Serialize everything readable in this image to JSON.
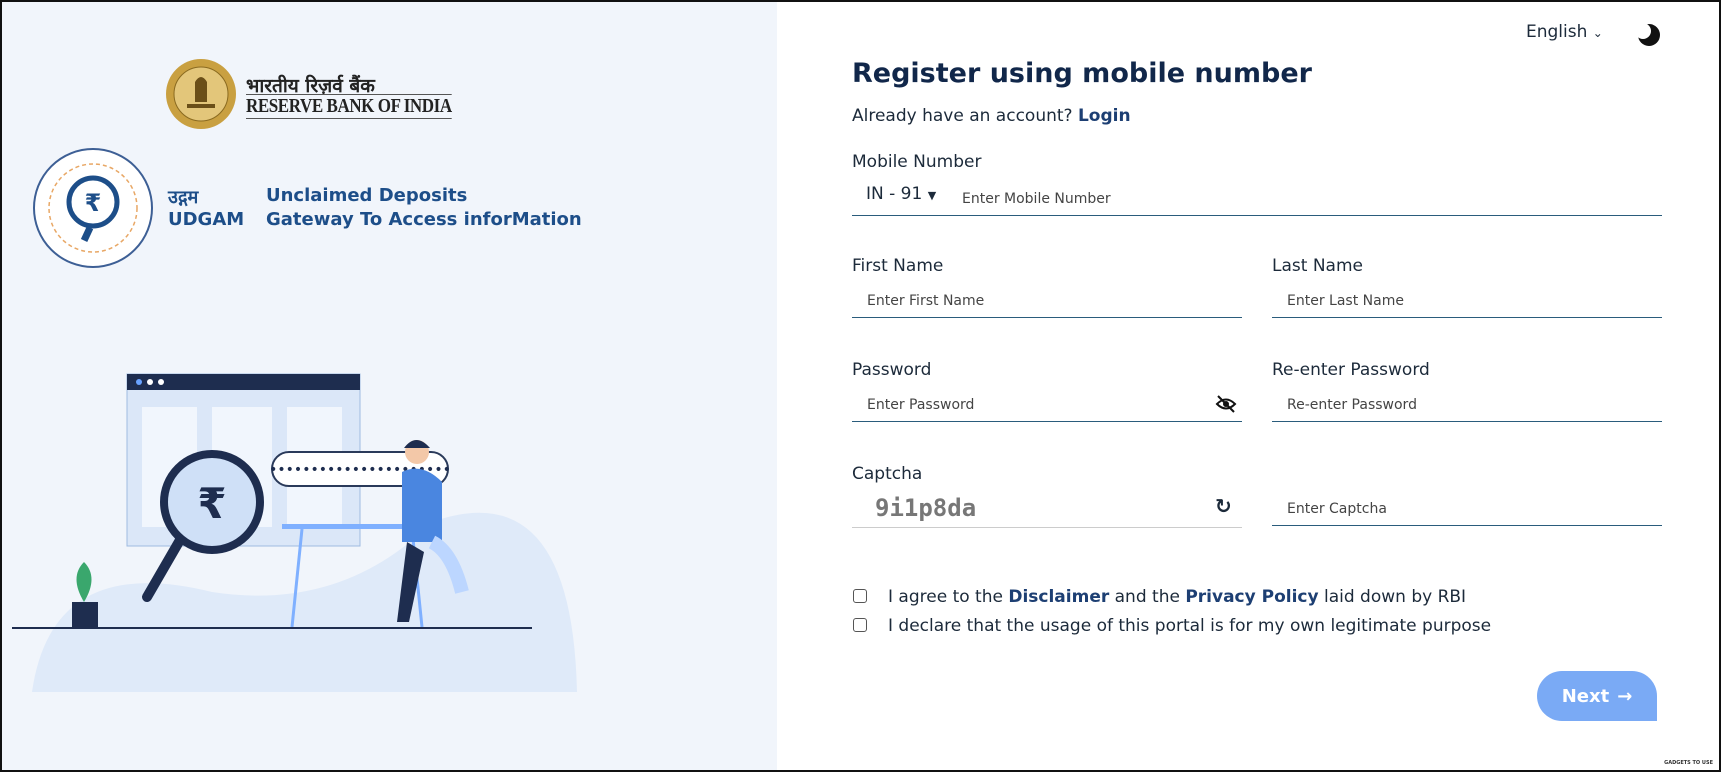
{
  "brand": {
    "rbi_hindi": "भारतीय रिज़र्व बैंक",
    "rbi_english": "RESERVE BANK OF INDIA",
    "udgam_hindi": "उद्गम",
    "udgam_english": "UDGAM",
    "udgam_line1": "Unclaimed Deposits",
    "udgam_line2": "Gateway To Access inforMation",
    "seal_text": "UDGAM · Unclaimed Deposits Gateway To Access inforMation"
  },
  "header": {
    "language": "English",
    "theme_icon": "moon-icon"
  },
  "form": {
    "title": "Register using mobile number",
    "already": "Already have an account?",
    "login": "Login",
    "mobile_label": "Mobile Number",
    "country_code": "IN - 91",
    "mobile_placeholder": "Enter Mobile Number",
    "first_label": "First Name",
    "first_placeholder": "Enter First Name",
    "last_label": "Last Name",
    "last_placeholder": "Enter Last Name",
    "password_label": "Password",
    "password_placeholder": "Enter Password",
    "repassword_label": "Re-enter Password",
    "repassword_placeholder": "Re-enter Password",
    "captcha_label": "Captcha",
    "captcha_value": "9i1p8da",
    "captcha_placeholder": "Enter Captcha",
    "agree_1": "I agree to the ",
    "disclaimer": "Disclaimer",
    "agree_2": " and the ",
    "privacy": "Privacy Policy",
    "agree_3": " laid down by RBI",
    "declare": "I declare that the usage of this portal is for my own legitimate purpose",
    "next": "Next"
  },
  "watermark": "GADGETS TO USE",
  "colors": {
    "accent": "#1d3f73",
    "button": "#7aaaf5",
    "panel": "#f1f5fb"
  }
}
